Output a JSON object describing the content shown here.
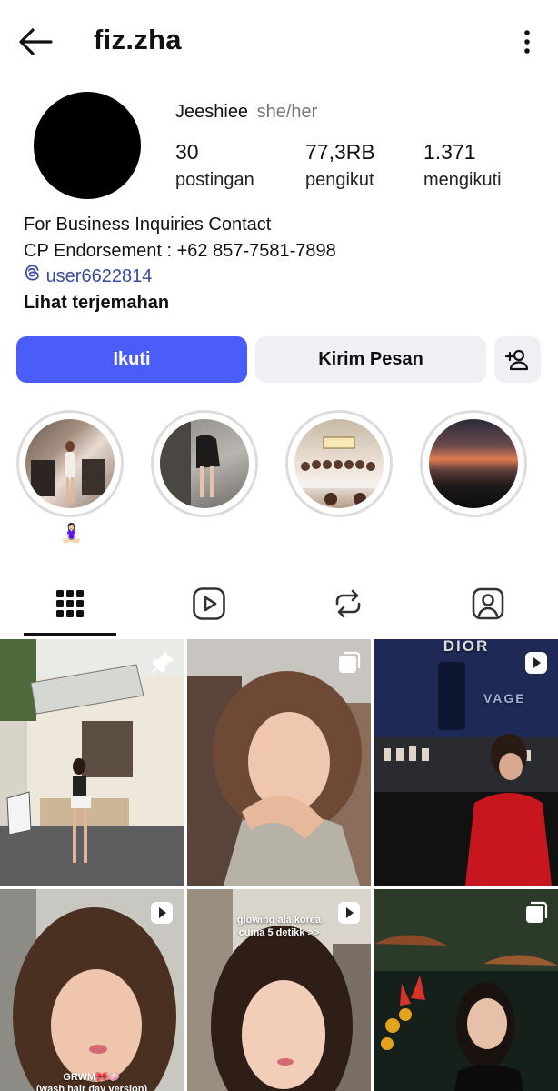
{
  "header": {
    "username": "fiz.zha",
    "back_icon": "arrow-left-icon",
    "more_icon": "kebab-menu-icon"
  },
  "profile": {
    "display_name": "Jeeshiee",
    "pronouns": "she/her",
    "stats": [
      {
        "value": "30",
        "label": "postingan"
      },
      {
        "value": "77,3RB",
        "label": "pengikut"
      },
      {
        "value": "1.371",
        "label": "mengikuti"
      }
    ],
    "bio": {
      "line1": "For Business Inquiries Contact",
      "line2": "CP Endorsement : +62 857-7581-7898",
      "threads_handle": "user6622814",
      "translate": "Lihat terjemahan"
    }
  },
  "actions": {
    "follow": "Ikuti",
    "message": "Kirim Pesan",
    "suggest_icon": "add-person-icon"
  },
  "highlights": {
    "first_label": "🧘🏻‍♀️",
    "count": 4
  },
  "tabs": [
    {
      "icon": "grid-icon",
      "active": true
    },
    {
      "icon": "reels-icon",
      "active": false
    },
    {
      "icon": "repost-icon",
      "active": false
    },
    {
      "icon": "tagged-icon",
      "active": false
    }
  ],
  "posts": {
    "overlay_1": "glowing ala korea",
    "overlay_2": "cuma 5 detikk >>",
    "overlay_3": "GRWM🎀🧼",
    "overlay_4": "(wash hair day version)",
    "dior_text": "DIOR",
    "sauvage_text": "VAGE"
  },
  "colors": {
    "follow_button": "#4a5df9",
    "secondary_button": "#eff0f3",
    "link": "#3b4a9e"
  }
}
